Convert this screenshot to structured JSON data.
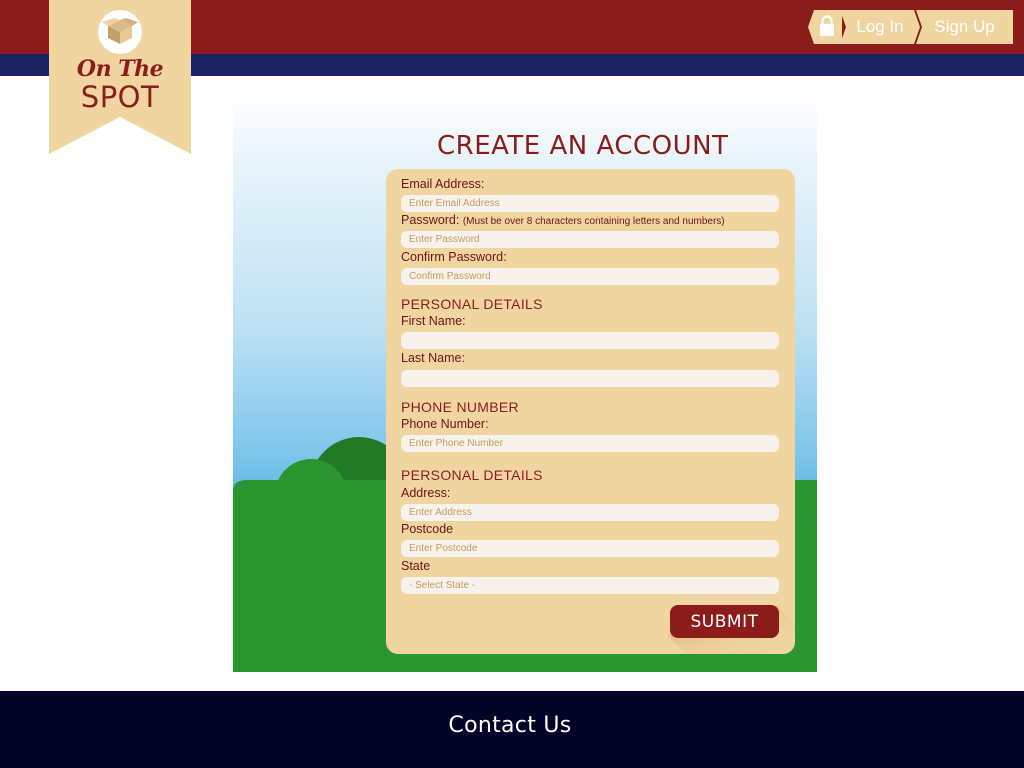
{
  "header": {
    "brand_top": "On The",
    "brand_bottom": "SPOT",
    "logo_icon": "open-box-icon",
    "nav": {
      "lock_icon": "padlock-icon",
      "login_label": "Log In",
      "signup_label": "Sign Up"
    }
  },
  "form": {
    "title": "CREATE AN ACCOUNT",
    "email": {
      "label": "Email Address:",
      "placeholder": "Enter Email Address"
    },
    "password": {
      "label": "Password:",
      "hint": "(Must be over 8 characters containing letters and numbers)",
      "placeholder": "Enter Password"
    },
    "confirm_password": {
      "label": "Confirm Password:",
      "placeholder": "Confirm Password"
    },
    "personal_section": "PERSONAL DETAILS",
    "first_name": {
      "label": "First Name:",
      "placeholder": ""
    },
    "last_name": {
      "label": "Last Name:",
      "placeholder": ""
    },
    "phone_section": "PHONE NUMBER",
    "phone": {
      "label": "Phone Number:",
      "placeholder": "Enter Phone Number"
    },
    "address_section": "PERSONAL DETAILS",
    "address": {
      "label": "Address:",
      "placeholder": "Enter Address"
    },
    "postcode": {
      "label": "Postcode",
      "placeholder": "Enter Postcode"
    },
    "state": {
      "label": "State",
      "selected": "- Select State -"
    },
    "submit_label": "SUBMIT"
  },
  "footer": {
    "contact_label": "Contact Us"
  },
  "colors": {
    "brand_red": "#8b1c1a",
    "navy": "#1b2263",
    "footer_bg": "#020427",
    "card_bg": "#f1d5a0",
    "ribbon_bg": "#f1d5a0",
    "grass": "#2b9530"
  }
}
